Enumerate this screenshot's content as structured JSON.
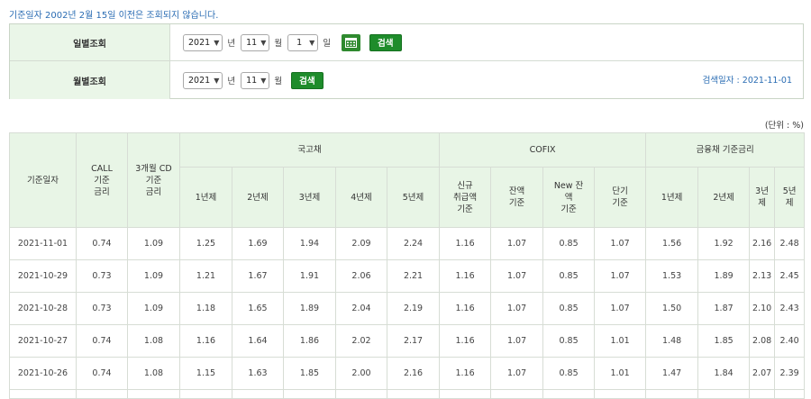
{
  "notice": "기준일자 2002년 2월 15일 이전은 조회되지 않습니다.",
  "search": {
    "daily": {
      "label": "일별조회",
      "year": "2021",
      "year_unit": "년",
      "month": "11",
      "month_unit": "월",
      "day": "1",
      "day_unit": "일",
      "search_label": "검색"
    },
    "monthly": {
      "label": "월별조회",
      "year": "2021",
      "year_unit": "년",
      "month": "11",
      "month_unit": "월",
      "search_label": "검색"
    },
    "search_date": "검색일자 : 2021-11-01"
  },
  "unit_note": "(단위 : %)",
  "table": {
    "headers": {
      "date": "기준일자",
      "call": "CALL\n기준\n금리",
      "cd": "3개월 CD\n기준\n금리",
      "treasury": "국고채",
      "cofix": "COFIX",
      "finance": "금융채 기준금리",
      "treasury_cols": [
        "1년제",
        "2년제",
        "3년제",
        "4년제",
        "5년제"
      ],
      "cofix_cols": [
        "신규\n취급액\n기준",
        "잔액\n기준",
        "New 잔\n액\n기준",
        "단기\n기준"
      ],
      "finance_cols": [
        "1년제",
        "2년제",
        "3년\n제",
        "5년\n제"
      ]
    },
    "rows": [
      [
        "2021-11-01",
        "0.74",
        "1.09",
        "1.25",
        "1.69",
        "1.94",
        "2.09",
        "2.24",
        "1.16",
        "1.07",
        "0.85",
        "1.07",
        "1.56",
        "1.92",
        "2.16",
        "2.48"
      ],
      [
        "2021-10-29",
        "0.73",
        "1.09",
        "1.21",
        "1.67",
        "1.91",
        "2.06",
        "2.21",
        "1.16",
        "1.07",
        "0.85",
        "1.07",
        "1.53",
        "1.89",
        "2.13",
        "2.45"
      ],
      [
        "2021-10-28",
        "0.73",
        "1.09",
        "1.18",
        "1.65",
        "1.89",
        "2.04",
        "2.19",
        "1.16",
        "1.07",
        "0.85",
        "1.07",
        "1.50",
        "1.87",
        "2.10",
        "2.43"
      ],
      [
        "2021-10-27",
        "0.74",
        "1.08",
        "1.16",
        "1.64",
        "1.86",
        "2.02",
        "2.17",
        "1.16",
        "1.07",
        "0.85",
        "1.01",
        "1.48",
        "1.85",
        "2.08",
        "2.40"
      ],
      [
        "2021-10-26",
        "0.74",
        "1.08",
        "1.15",
        "1.63",
        "1.85",
        "2.00",
        "2.16",
        "1.16",
        "1.07",
        "0.85",
        "1.01",
        "1.47",
        "1.84",
        "2.07",
        "2.39"
      ]
    ]
  }
}
